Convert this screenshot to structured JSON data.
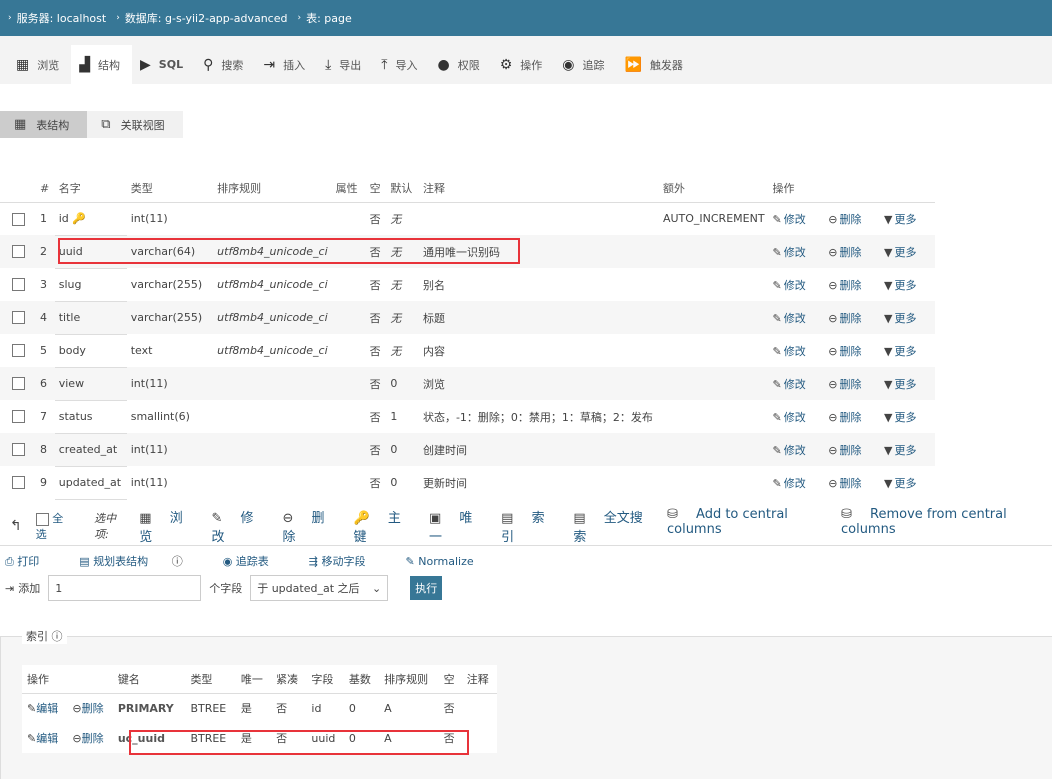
{
  "breadcrumb": [
    "服务器: localhost",
    "数据库: g-s-yii2-app-advanced",
    "表: page"
  ],
  "tabs": [
    {
      "label": "浏览",
      "icon": "browse-icon"
    },
    {
      "label": "结构",
      "icon": "structure-icon"
    },
    {
      "label": "SQL",
      "icon": "sql-icon"
    },
    {
      "label": "搜索",
      "icon": "search-icon"
    },
    {
      "label": "插入",
      "icon": "insert-icon"
    },
    {
      "label": "导出",
      "icon": "export-icon"
    },
    {
      "label": "导入",
      "icon": "import-icon"
    },
    {
      "label": "权限",
      "icon": "user-icon"
    },
    {
      "label": "操作",
      "icon": "gear-icon"
    },
    {
      "label": "追踪",
      "icon": "eye-icon"
    },
    {
      "label": "触发器",
      "icon": "trigger-icon"
    }
  ],
  "subtabs": [
    "表结构",
    "关联视图"
  ],
  "columns": [
    "#",
    "名字",
    "类型",
    "排序规则",
    "属性",
    "空",
    "默认",
    "注释",
    "额外",
    "操作"
  ],
  "rows": [
    {
      "n": "1",
      "name": "id",
      "type": "int(11)",
      "coll": "",
      "attr": "",
      "null": "否",
      "def": "无",
      "comment": "",
      "extra": "AUTO_INCREMENT"
    },
    {
      "n": "2",
      "name": "uuid",
      "type": "varchar(64)",
      "coll": "utf8mb4_unicode_ci",
      "attr": "",
      "null": "否",
      "def": "无",
      "comment": "通用唯一识别码",
      "extra": ""
    },
    {
      "n": "3",
      "name": "slug",
      "type": "varchar(255)",
      "coll": "utf8mb4_unicode_ci",
      "attr": "",
      "null": "否",
      "def": "无",
      "comment": "别名",
      "extra": ""
    },
    {
      "n": "4",
      "name": "title",
      "type": "varchar(255)",
      "coll": "utf8mb4_unicode_ci",
      "attr": "",
      "null": "否",
      "def": "无",
      "comment": "标题",
      "extra": ""
    },
    {
      "n": "5",
      "name": "body",
      "type": "text",
      "coll": "utf8mb4_unicode_ci",
      "attr": "",
      "null": "否",
      "def": "无",
      "comment": "内容",
      "extra": ""
    },
    {
      "n": "6",
      "name": "view",
      "type": "int(11)",
      "coll": "",
      "attr": "",
      "null": "否",
      "def": "0",
      "comment": "浏览",
      "extra": ""
    },
    {
      "n": "7",
      "name": "status",
      "type": "smallint(6)",
      "coll": "",
      "attr": "",
      "null": "否",
      "def": "1",
      "comment": "状态，-1：删除；0：禁用；1：草稿；2：发布",
      "extra": ""
    },
    {
      "n": "8",
      "name": "created_at",
      "type": "int(11)",
      "coll": "",
      "attr": "",
      "null": "否",
      "def": "0",
      "comment": "创建时间",
      "extra": ""
    },
    {
      "n": "9",
      "name": "updated_at",
      "type": "int(11)",
      "coll": "",
      "attr": "",
      "null": "否",
      "def": "0",
      "comment": "更新时间",
      "extra": ""
    }
  ],
  "row_actions": {
    "edit": "修改",
    "drop": "删除",
    "more": "更多"
  },
  "bulk": {
    "check_all": "全选",
    "with_selected": "选中项:",
    "actions": [
      "浏览",
      "修改",
      "删除",
      "主键",
      "唯一",
      "索引",
      "全文搜索",
      "Add to central columns",
      "Remove from central columns"
    ]
  },
  "tools": [
    "打印",
    "规划表结构",
    "追踪表",
    "移动字段",
    "Normalize"
  ],
  "add": {
    "label": "添加",
    "value": "1",
    "unit": "个字段",
    "position": "于 updated_at 之后",
    "go": "执行"
  },
  "indexes": {
    "legend": "索引",
    "columns": [
      "操作",
      "",
      "键名",
      "类型",
      "唯一",
      "紧凑",
      "字段",
      "基数",
      "排序规则",
      "空",
      "注释"
    ],
    "edit": "编辑",
    "drop": "删除",
    "rows": [
      {
        "key": "PRIMARY",
        "type": "BTREE",
        "unique": "是",
        "packed": "否",
        "field": "id",
        "card": "0",
        "coll": "A",
        "null": "否",
        "comment": ""
      },
      {
        "key": "uc_uuid",
        "type": "BTREE",
        "unique": "是",
        "packed": "否",
        "field": "uuid",
        "card": "0",
        "coll": "A",
        "null": "否",
        "comment": ""
      }
    ]
  }
}
